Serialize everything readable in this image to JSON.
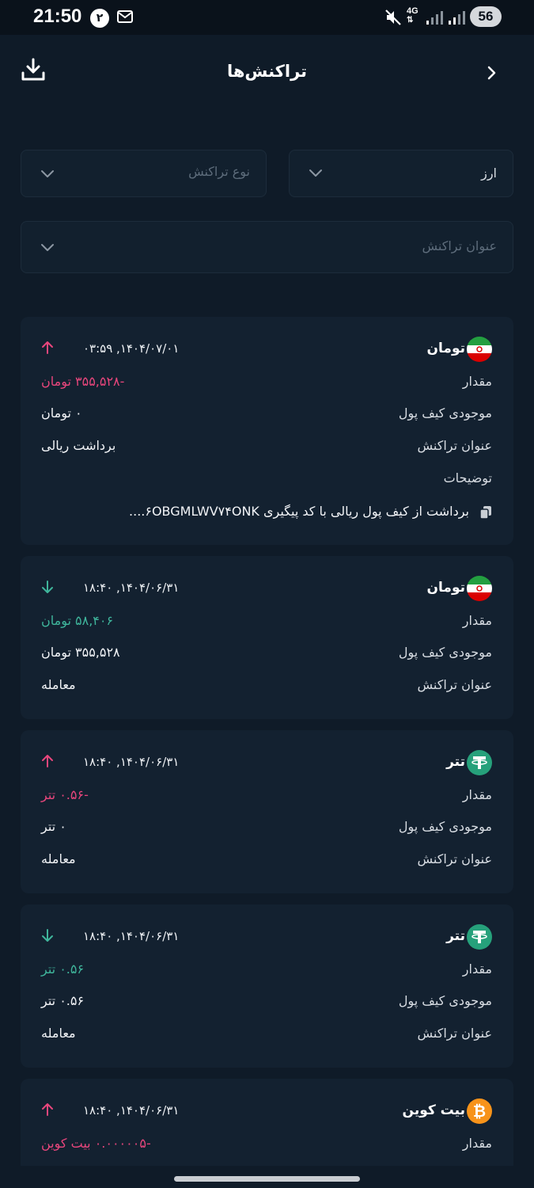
{
  "status_bar": {
    "time": "21:50",
    "notification_count": "۲",
    "network": "4G",
    "battery": "56"
  },
  "header": {
    "title": "تراکنش‌ها"
  },
  "filters": {
    "currency": "ارز",
    "type_placeholder": "نوع تراکنش",
    "title_placeholder": "عنوان تراکنش"
  },
  "labels": {
    "amount": "مقدار",
    "balance": "موجودی کیف پول",
    "tx_title": "عنوان تراکنش",
    "description": "توضیحات"
  },
  "transactions": [
    {
      "currency": "تومان",
      "icon": "iran-flag-icon",
      "datetime": "۰۳:۵۹ ,۱۴۰۴/۰۷/۰۱",
      "direction": "out",
      "amount": "-۳۵۵,۵۲۸ تومان",
      "balance": "۰ تومان",
      "tx_title": "برداشت ریالی",
      "description": "برداشت از کیف پول ریالی با کد پیگیری ۶OBGMLWV۷۴ONK...."
    },
    {
      "currency": "تومان",
      "icon": "iran-flag-icon",
      "datetime": "۱۸:۴۰ ,۱۴۰۴/۰۶/۳۱",
      "direction": "in",
      "amount": "۵۸,۴۰۶ تومان",
      "balance": "۳۵۵,۵۲۸ تومان",
      "tx_title": "معامله"
    },
    {
      "currency": "تتر",
      "icon": "tether-icon",
      "datetime": "۱۸:۴۰ ,۱۴۰۴/۰۶/۳۱",
      "direction": "out",
      "amount": "-۰.۵۶ تتر",
      "balance": "۰ تتر",
      "tx_title": "معامله"
    },
    {
      "currency": "تتر",
      "icon": "tether-icon",
      "datetime": "۱۸:۴۰ ,۱۴۰۴/۰۶/۳۱",
      "direction": "in",
      "amount": "۰.۵۶ تتر",
      "balance": "۰.۵۶ تتر",
      "tx_title": "معامله"
    },
    {
      "currency": "بیت کوین",
      "icon": "bitcoin-icon",
      "datetime": "۱۸:۴۰ ,۱۴۰۴/۰۶/۳۱",
      "direction": "out",
      "amount": "-۰.۰۰۰۰۰۵ بیت کوین"
    }
  ],
  "colors": {
    "background": "#0f1b28",
    "card": "#132130",
    "negative": "#e8467c",
    "positive": "#3fb59b",
    "tether": "#26a17b",
    "bitcoin": "#f7931a"
  }
}
